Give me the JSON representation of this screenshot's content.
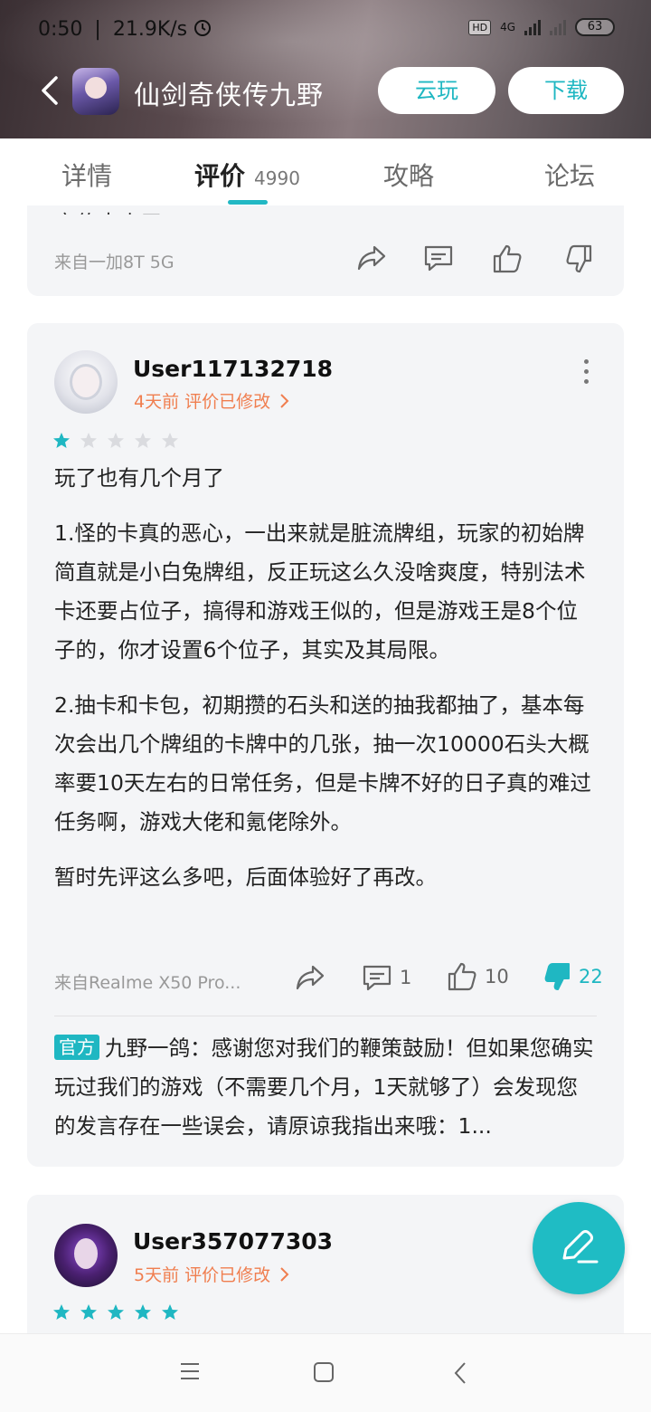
{
  "status_bar": {
    "time": "0:50",
    "speed": "21.9K/s",
    "hd": "HD",
    "network": "4G",
    "battery": "63"
  },
  "app_bar": {
    "title": "仙剑奇侠传九野",
    "cloud_play_label": "云玩",
    "download_label": "下载",
    "accent_color": "#1fb7c2"
  },
  "tabs": [
    {
      "label": "详情"
    },
    {
      "label": "评价",
      "count": "4990",
      "active": true
    },
    {
      "label": "攻略"
    },
    {
      "label": "论坛"
    }
  ],
  "prev_review": {
    "clipped_text": "宣传太少了",
    "device": "来自一加8T 5G"
  },
  "review": {
    "username": "User117132718",
    "meta": "4天前 评价已修改",
    "rating": 1,
    "paragraphs": [
      "玩了也有几个月了",
      "1.怪的卡真的恶心，一出来就是脏流牌组，玩家的初始牌简直就是小白兔牌组，反正玩这么久没啥爽度，特别法术卡还要占位子，搞得和游戏王似的，但是游戏王是8个位子的，你才设置6个位子，其实及其局限。",
      "2.抽卡和卡包，初期攒的石头和送的抽我都抽了，基本每次会出几个牌组的卡牌中的几张，抽一次10000石头大概率要10天左右的日常任务，但是卡牌不好的日子真的难过任务啊，游戏大佬和氪佬除外。",
      "暂时先评这么多吧，后面体验好了再改。"
    ],
    "device": "来自Realme X50 Pro...",
    "comments": "1",
    "likes": "10",
    "dislikes": "22",
    "reply": {
      "badge": "官方",
      "text": "九野一鸽：感谢您对我们的鞭策鼓励！但如果您确实玩过我们的游戏（不需要几个月，1天就够了）会发现您的发言存在一些误会，请原谅我指出来哦：1..."
    }
  },
  "next_review": {
    "username": "User357077303",
    "meta": "5天前 评价已修改",
    "rating": 5
  }
}
